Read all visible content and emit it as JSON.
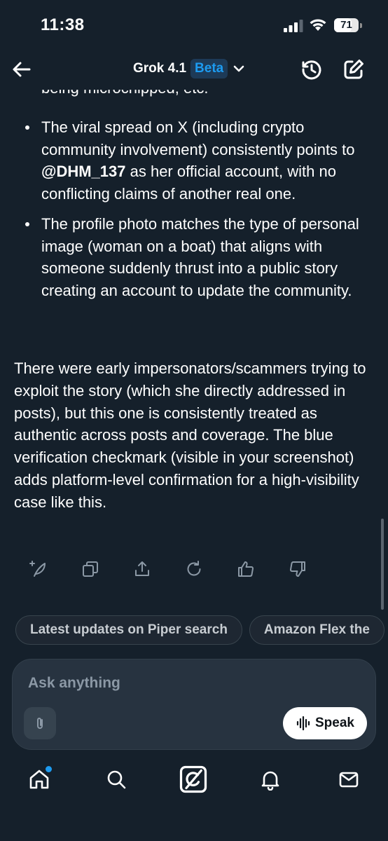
{
  "status": {
    "time": "11:38",
    "battery": "71",
    "battery_level": 0.71
  },
  "header": {
    "model": "Grok 4.1",
    "badge": "Beta"
  },
  "content": {
    "cut_line": "being microchipped, etc.",
    "bullets": [
      {
        "before": "The viral spread on X (including crypto community involvement) consistently points to ",
        "mention": "@DHM_137",
        "after": " as her official account, with no conflicting claims of another real one."
      },
      {
        "text": "The profile photo matches the type of personal image (woman on a boat) that aligns with someone suddenly thrust into a public story creating an account to update the community."
      }
    ],
    "paragraph": "There were early impersonators/scammers trying to exploit the story (which she directly addressed in posts), but this one is consistently treated as authentic across posts and coverage. The blue verification checkmark (visible in your screenshot) adds platform-level confirmation for a high-visibility case like this."
  },
  "actions": [
    "sparkle-feather-icon",
    "copy-icon",
    "share-icon",
    "regenerate-icon",
    "thumbs-up-icon",
    "thumbs-down-icon"
  ],
  "suggestions": [
    "Latest updates on Piper search",
    "Amazon Flex the"
  ],
  "input": {
    "placeholder": "Ask anything",
    "speak_label": "Speak"
  },
  "nav": [
    "home-icon",
    "search-icon",
    "grok-icon",
    "notifications-icon",
    "messages-icon"
  ],
  "colors": {
    "background": "#15202b",
    "accent": "#1d9bf0",
    "input_panel": "#273340"
  }
}
